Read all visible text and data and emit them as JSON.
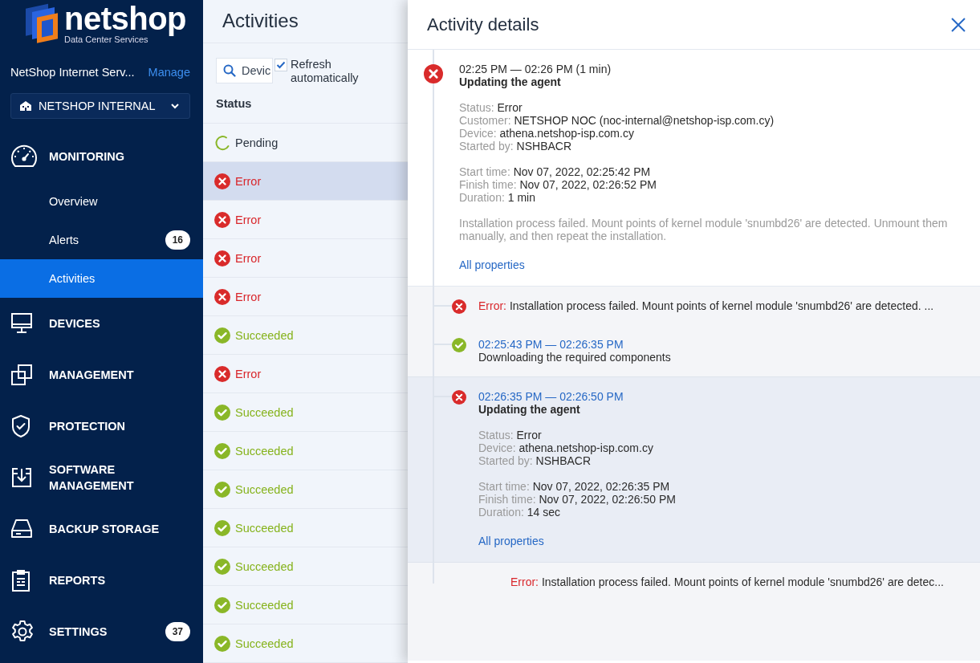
{
  "sidebar": {
    "logo": {
      "name": "netshop",
      "tagline": "Data Center Services"
    },
    "organization": {
      "name": "NetShop Internet Serv...",
      "action": "Manage"
    },
    "tenant": {
      "label": "NETSHOP INTERNAL"
    },
    "items": [
      {
        "kind": "monitoring",
        "label": "MONITORING",
        "children": [
          {
            "label": "Overview",
            "selected": false
          },
          {
            "label": "Alerts",
            "badge": "16",
            "selected": false
          },
          {
            "label": "Activities",
            "selected": true
          }
        ]
      },
      {
        "kind": "devices",
        "label": "DEVICES"
      },
      {
        "kind": "management",
        "label": "MANAGEMENT"
      },
      {
        "kind": "protection",
        "label": "PROTECTION"
      },
      {
        "kind": "software",
        "label": "SOFTWARE MANAGEMENT"
      },
      {
        "kind": "storage",
        "label": "BACKUP STORAGE"
      },
      {
        "kind": "reports",
        "label": "REPORTS"
      },
      {
        "kind": "settings",
        "label": "SETTINGS",
        "badge": "37"
      }
    ]
  },
  "activities": {
    "title": "Activities",
    "search": {
      "placeholder": "Devic"
    },
    "refresh": {
      "label": "Refresh automatically",
      "checked": true
    },
    "columns": [
      "Status"
    ],
    "rows": [
      {
        "kind": "pending",
        "label": "Pending",
        "selected": false
      },
      {
        "kind": "error",
        "label": "Error",
        "selected": true
      },
      {
        "kind": "error",
        "label": "Error",
        "selected": false
      },
      {
        "kind": "error",
        "label": "Error",
        "selected": false
      },
      {
        "kind": "error",
        "label": "Error",
        "selected": false
      },
      {
        "kind": "success",
        "label": "Succeeded",
        "selected": false
      },
      {
        "kind": "error",
        "label": "Error",
        "selected": false
      },
      {
        "kind": "success",
        "label": "Succeeded",
        "selected": false
      },
      {
        "kind": "success",
        "label": "Succeeded",
        "selected": false
      },
      {
        "kind": "success",
        "label": "Succeeded",
        "selected": false
      },
      {
        "kind": "success",
        "label": "Succeeded",
        "selected": false
      },
      {
        "kind": "success",
        "label": "Succeeded",
        "selected": false
      },
      {
        "kind": "success",
        "label": "Succeeded",
        "selected": false
      },
      {
        "kind": "success",
        "label": "Succeeded",
        "selected": false
      }
    ]
  },
  "details": {
    "title": "Activity details",
    "main": {
      "failed": true,
      "time": "02:25 PM — 02:26 PM (1 min)",
      "title": "Updating the agent",
      "property_groups": [
        {
          "items": [
            {
              "label": "Status:",
              "value": "Error"
            },
            {
              "label": "Customer:",
              "value": "NETSHOP NOC (noc-internal@netshop-isp.com.cy)"
            },
            {
              "label": "Device:",
              "value": "athena.netshop-isp.com.cy"
            },
            {
              "label": "Started by:",
              "value": "NSHBACR"
            }
          ]
        },
        {
          "items": [
            {
              "label": "Start time:",
              "value": "Nov 07, 2022, 02:25:42 PM"
            },
            {
              "label": "Finish time:",
              "value": "Nov 07, 2022, 02:26:52 PM"
            },
            {
              "label": "Duration:",
              "value": "1 min"
            }
          ]
        }
      ],
      "message": "Installation process failed. Mount points of kernel module 'snumbd26' are detected. Unmount them manually, and then repeat the installation.",
      "link": "All properties"
    },
    "steps": [
      {
        "kind": "message",
        "failed": true,
        "label": "Error:",
        "text": "Installation process failed. Mount points of kernel module 'snumbd26' are detected. ..."
      },
      {
        "kind": "step",
        "failed": false,
        "selected": false,
        "time": "02:25:43 PM — 02:26:35 PM",
        "title": "Downloading the required components"
      },
      {
        "kind": "step",
        "failed": true,
        "selected": true,
        "time": "02:26:35 PM — 02:26:50 PM",
        "title": "Updating the agent",
        "property_groups": [
          {
            "items": [
              {
                "label": "Status:",
                "value": "Error"
              },
              {
                "label": "Device:",
                "value": "athena.netshop-isp.com.cy"
              },
              {
                "label": "Started by:",
                "value": "NSHBACR"
              }
            ]
          },
          {
            "items": [
              {
                "label": "Start time:",
                "value": "Nov 07, 2022, 02:26:35 PM"
              },
              {
                "label": "Finish time:",
                "value": "Nov 07, 2022, 02:26:50 PM"
              },
              {
                "label": "Duration:",
                "value": "14 sec"
              }
            ]
          }
        ],
        "link": "All properties",
        "children": [
          {
            "kind": "message",
            "label": "Error:",
            "text": "Installation process failed. Mount points of kernel module 'snumbd26' are detec..."
          }
        ]
      }
    ]
  }
}
